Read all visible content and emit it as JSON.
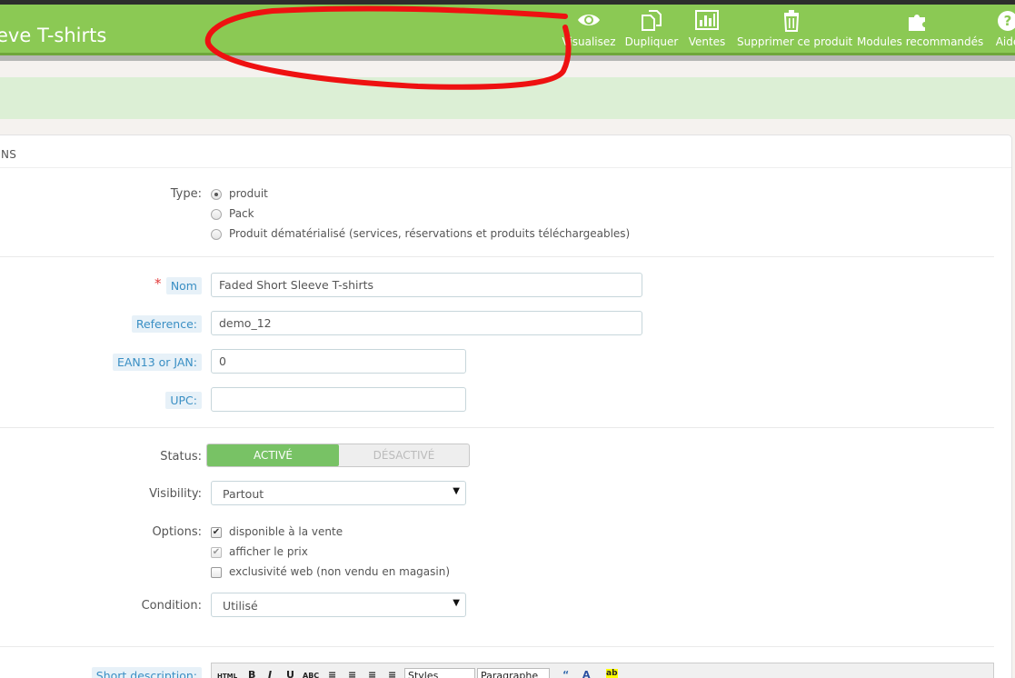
{
  "header": {
    "title": "eve T-shirts",
    "toolbar": [
      {
        "label": "Visualisez",
        "icon": "eye-icon"
      },
      {
        "label": "Dupliquer",
        "icon": "copy-icon"
      },
      {
        "label": "Ventes",
        "icon": "bar-chart-icon"
      },
      {
        "label": "Supprimer ce produit",
        "icon": "trash-icon"
      },
      {
        "label": "Modules recommandés",
        "icon": "puzzle-icon"
      },
      {
        "label": "Aide",
        "icon": "question-icon"
      }
    ]
  },
  "panel": {
    "heading": "NS"
  },
  "form": {
    "type": {
      "label": "Type:",
      "options": [
        {
          "label": "produit",
          "selected": true
        },
        {
          "label": "Pack",
          "selected": false
        },
        {
          "label": "Produit dématérialisé (services, réservations et produits téléchargeables)",
          "selected": false
        }
      ]
    },
    "name": {
      "label": "Nom",
      "required_mark": "*",
      "value": "Faded Short Sleeve T-shirts"
    },
    "reference": {
      "label": "Reference:",
      "value": "demo_12"
    },
    "ean13": {
      "label": "EAN13 or JAN:",
      "value": "0"
    },
    "upc": {
      "label": "UPC:",
      "value": ""
    },
    "status": {
      "label": "Status:",
      "on_label": "ACTIVÉ",
      "off_label": "DÉSACTIVÉ",
      "active": true
    },
    "visibility": {
      "label": "Visibility:",
      "value": "Partout"
    },
    "options": {
      "label": "Options:",
      "items": [
        {
          "label": "disponible à la vente",
          "checked": true
        },
        {
          "label": "afficher le prix",
          "checked": true
        },
        {
          "label": "exclusivité web (non vendu en magasin)",
          "checked": false
        }
      ]
    },
    "condition": {
      "label": "Condition:",
      "value": "Utilisé"
    },
    "short_description": {
      "label": "Short description:",
      "editor": {
        "styles": "Styles",
        "format": "Paragraphe"
      }
    }
  },
  "annotation": {
    "color": "#ee1111"
  }
}
